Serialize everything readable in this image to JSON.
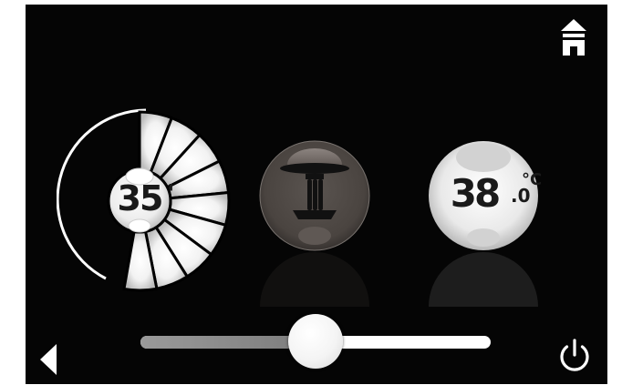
{
  "timer": {
    "value": "35",
    "unit": "'"
  },
  "temperature": {
    "value": "38",
    "decimal": ".0",
    "unit": "°C"
  },
  "slider": {
    "level": 0.5
  },
  "icons": {
    "home": "home-icon",
    "back": "back-arrow-icon",
    "power": "power-icon",
    "shower": "shower-head-icon"
  },
  "colors": {
    "background": "#050505",
    "accent": "#ffffff",
    "track_fill": "#8a8a8a"
  }
}
